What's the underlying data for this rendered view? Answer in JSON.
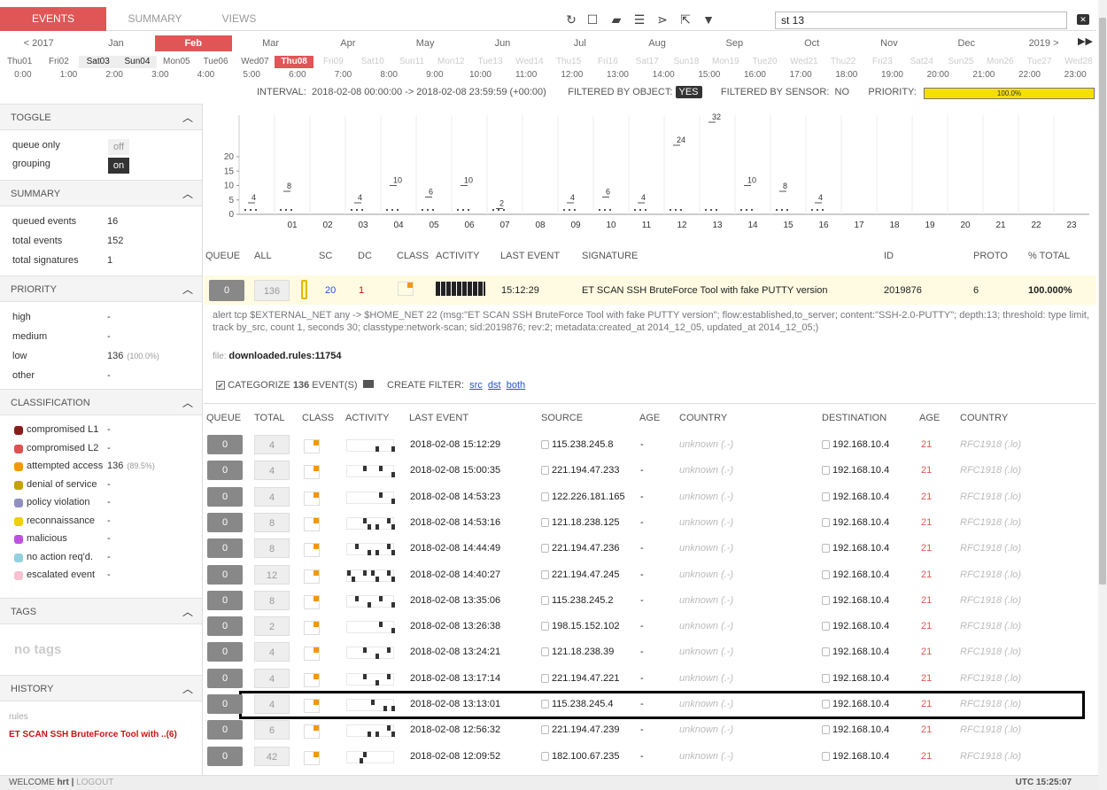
{
  "nav": {
    "tabs": [
      "EVENTS",
      "SUMMARY",
      "VIEWS"
    ],
    "search_value": "st 13"
  },
  "months": [
    "< 2017",
    "Jan",
    "Feb",
    "Mar",
    "Apr",
    "May",
    "Jun",
    "Jul",
    "Aug",
    "Sep",
    "Oct",
    "Nov",
    "Dec",
    "2019 >"
  ],
  "days": [
    "Thu01",
    "Fri02",
    "Sat03",
    "Sun04",
    "Mon05",
    "Tue06",
    "Wed07",
    "Thu08",
    "Fri09",
    "Sat10",
    "Sun11",
    "Mon12",
    "Tue13",
    "Wed14",
    "Thu15",
    "Fri16",
    "Sat17",
    "Sun18",
    "Mon19",
    "Tue20",
    "Wed21",
    "Thu22",
    "Fri23",
    "Sat24",
    "Sun25",
    "Mon26",
    "Tue27",
    "Wed28"
  ],
  "hours": [
    "0:00",
    "1:00",
    "2:00",
    "3:00",
    "4:00",
    "5:00",
    "6:00",
    "7:00",
    "8:00",
    "9:00",
    "10:00",
    "11:00",
    "12:00",
    "13:00",
    "14:00",
    "15:00",
    "16:00",
    "17:00",
    "18:00",
    "19:00",
    "20:00",
    "21:00",
    "22:00",
    "23:00"
  ],
  "interval": {
    "label": "INTERVAL:",
    "value": "2018-02-08 00:00:00 -> 2018-02-08 23:59:59 (+00:00)",
    "filtered_object_label": "FILTERED BY OBJECT:",
    "filtered_object": "YES",
    "filtered_sensor_label": "FILTERED BY SENSOR:",
    "filtered_sensor": "NO",
    "priority_label": "PRIORITY:",
    "priority": "100.0%"
  },
  "sidebar": {
    "toggle": {
      "title": "TOGGLE",
      "items": [
        {
          "label": "queue only",
          "state": "off"
        },
        {
          "label": "grouping",
          "state": "on"
        }
      ]
    },
    "summary": {
      "title": "SUMMARY",
      "items": [
        {
          "label": "queued events",
          "value": "16"
        },
        {
          "label": "total events",
          "value": "152"
        },
        {
          "label": "total signatures",
          "value": "1"
        }
      ]
    },
    "priority": {
      "title": "PRIORITY",
      "items": [
        {
          "label": "high",
          "value": "-"
        },
        {
          "label": "medium",
          "value": "-"
        },
        {
          "label": "low",
          "value": "136",
          "pct": "(100.0%)"
        },
        {
          "label": "other",
          "value": "-"
        }
      ]
    },
    "classification": {
      "title": "CLASSIFICATION",
      "items": [
        {
          "label": "compromised L1",
          "value": "-",
          "color": "#8b1a1a"
        },
        {
          "label": "compromised L2",
          "value": "-",
          "color": "#e05050"
        },
        {
          "label": "attempted access",
          "value": "136",
          "pct": "(89.5%)",
          "color": "#f39800"
        },
        {
          "label": "denial of service",
          "value": "-",
          "color": "#c8a000"
        },
        {
          "label": "policy violation",
          "value": "-",
          "color": "#9090c0"
        },
        {
          "label": "reconnaissance",
          "value": "-",
          "color": "#f0d000"
        },
        {
          "label": "malicious",
          "value": "-",
          "color": "#c050e0"
        },
        {
          "label": "no action req'd.",
          "value": "-",
          "color": "#90d0e0"
        },
        {
          "label": "escalated event",
          "value": "-",
          "color": "#f8c0d0"
        }
      ]
    },
    "tags": {
      "title": "TAGS",
      "empty": "no tags"
    },
    "history": {
      "title": "HISTORY",
      "sublabel": "rules",
      "item": "ET SCAN SSH BruteForce Tool with ..(6)"
    }
  },
  "chart_data": {
    "type": "scatter",
    "x": [
      "00",
      "01",
      "02",
      "03",
      "04",
      "05",
      "06",
      "07",
      "08",
      "09",
      "10",
      "11",
      "12",
      "13",
      "14",
      "15",
      "16",
      "17",
      "18",
      "19",
      "20",
      "21",
      "22",
      "23"
    ],
    "peaks": [
      4,
      8,
      0,
      4,
      10,
      6,
      10,
      2,
      0,
      4,
      6,
      4,
      24,
      32,
      10,
      8,
      4,
      0,
      0,
      0,
      0,
      0,
      0,
      0
    ],
    "y_ticks": [
      "0",
      "5",
      "10",
      "15",
      "20"
    ],
    "ylim": [
      0,
      32
    ]
  },
  "sig_headers": [
    "QUEUE",
    "ALL",
    "SC",
    "DC",
    "CLASS",
    "ACTIVITY",
    "LAST EVENT",
    "SIGNATURE",
    "ID",
    "PROTO",
    "% TOTAL"
  ],
  "signature": {
    "queue": "0",
    "all": "136",
    "sc": "20",
    "dc": "1",
    "last": "15:12:29",
    "name": "ET SCAN SSH BruteForce Tool with fake PUTTY version",
    "id": "2019876",
    "proto": "6",
    "pct": "100.000%"
  },
  "rule_text": "alert tcp $EXTERNAL_NET any -> $HOME_NET 22 (msg:\"ET SCAN SSH BruteForce Tool with fake PUTTY version\"; flow:established,to_server; content:\"SSH-2.0-PUTTY\"; depth:13; threshold: type limit, track by_src, count 1, seconds 30; classtype:network-scan; sid:2019876; rev:2; metadata:created_at 2014_12_05, updated_at 2014_12_05;)",
  "file": {
    "label": "file:",
    "value": "downloaded.rules:11754"
  },
  "categorize": {
    "label": "CATEGORIZE",
    "count": "136",
    "suffix": "EVENT(S)",
    "create": "CREATE FILTER:",
    "src": "src",
    "dst": "dst",
    "both": "both"
  },
  "event_headers": [
    "QUEUE",
    "TOTAL",
    "CLASS",
    "ACTIVITY",
    "LAST EVENT",
    "SOURCE",
    "AGE",
    "COUNTRY",
    "DESTINATION",
    "AGE",
    "COUNTRY"
  ],
  "events": [
    {
      "q": "0",
      "total": "4",
      "last": "2018-02-08 15:12:29",
      "src": "115.238.245.8",
      "sage": "-",
      "scountry": "unknown (.-)",
      "dst": "192.168.10.4",
      "dage": "21",
      "dcountry": "RFC1918 (.lo)"
    },
    {
      "q": "0",
      "total": "4",
      "last": "2018-02-08 15:00:35",
      "src": "221.194.47.233",
      "sage": "-",
      "scountry": "unknown (.-)",
      "dst": "192.168.10.4",
      "dage": "21",
      "dcountry": "RFC1918 (.lo)"
    },
    {
      "q": "0",
      "total": "4",
      "last": "2018-02-08 14:53:23",
      "src": "122.226.181.165",
      "sage": "-",
      "scountry": "unknown (.-)",
      "dst": "192.168.10.4",
      "dage": "21",
      "dcountry": "RFC1918 (.lo)"
    },
    {
      "q": "0",
      "total": "8",
      "last": "2018-02-08 14:53:16",
      "src": "121.18.238.125",
      "sage": "-",
      "scountry": "unknown (.-)",
      "dst": "192.168.10.4",
      "dage": "21",
      "dcountry": "RFC1918 (.lo)"
    },
    {
      "q": "0",
      "total": "8",
      "last": "2018-02-08 14:44:49",
      "src": "221.194.47.236",
      "sage": "-",
      "scountry": "unknown (.-)",
      "dst": "192.168.10.4",
      "dage": "21",
      "dcountry": "RFC1918 (.lo)"
    },
    {
      "q": "0",
      "total": "12",
      "last": "2018-02-08 14:40:27",
      "src": "221.194.47.245",
      "sage": "-",
      "scountry": "unknown (.-)",
      "dst": "192.168.10.4",
      "dage": "21",
      "dcountry": "RFC1918 (.lo)"
    },
    {
      "q": "0",
      "total": "8",
      "last": "2018-02-08 13:35:06",
      "src": "115.238.245.2",
      "sage": "-",
      "scountry": "unknown (.-)",
      "dst": "192.168.10.4",
      "dage": "21",
      "dcountry": "RFC1918 (.lo)"
    },
    {
      "q": "0",
      "total": "2",
      "last": "2018-02-08 13:26:38",
      "src": "198.15.152.102",
      "sage": "-",
      "scountry": "unknown (.-)",
      "dst": "192.168.10.4",
      "dage": "21",
      "dcountry": "RFC1918 (.lo)"
    },
    {
      "q": "0",
      "total": "4",
      "last": "2018-02-08 13:24:21",
      "src": "121.18.238.39",
      "sage": "-",
      "scountry": "unknown (.-)",
      "dst": "192.168.10.4",
      "dage": "21",
      "dcountry": "RFC1918 (.lo)"
    },
    {
      "q": "0",
      "total": "4",
      "last": "2018-02-08 13:17:14",
      "src": "221.194.47.221",
      "sage": "-",
      "scountry": "unknown (.-)",
      "dst": "192.168.10.4",
      "dage": "21",
      "dcountry": "RFC1918 (.lo)"
    },
    {
      "q": "0",
      "total": "4",
      "last": "2018-02-08 13:13:01",
      "src": "115.238.245.4",
      "sage": "-",
      "scountry": "unknown (.-)",
      "dst": "192.168.10.4",
      "dage": "21",
      "dcountry": "RFC1918 (.lo)"
    },
    {
      "q": "0",
      "total": "6",
      "last": "2018-02-08 12:56:32",
      "src": "221.194.47.239",
      "sage": "-",
      "scountry": "unknown (.-)",
      "dst": "192.168.10.4",
      "dage": "21",
      "dcountry": "RFC1918 (.lo)"
    },
    {
      "q": "0",
      "total": "42",
      "last": "2018-02-08 12:09:52",
      "src": "182.100.67.235",
      "sage": "-",
      "scountry": "unknown (.-)",
      "dst": "192.168.10.4",
      "dage": "21",
      "dcountry": "RFC1918 (.lo)"
    }
  ],
  "footer": {
    "welcome": "WELCOME",
    "user": "hrt",
    "sep": "|",
    "logout": "LOGOUT",
    "clock": "UTC 15:25:07"
  }
}
